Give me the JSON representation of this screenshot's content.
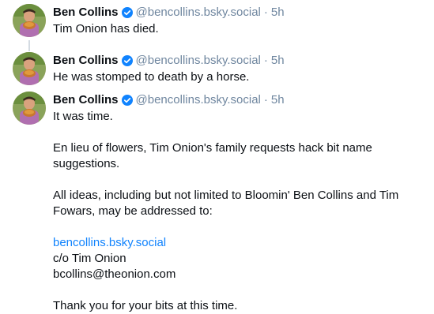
{
  "posts": [
    {
      "author": "Ben Collins",
      "handle": "@bencollins.bsky.social",
      "separator": "·",
      "time": "5h",
      "text": "Tim Onion has died."
    },
    {
      "author": "Ben Collins",
      "handle": "@bencollins.bsky.social",
      "separator": "·",
      "time": "5h",
      "text": "He was stomped to death by a horse."
    },
    {
      "author": "Ben Collins",
      "handle": "@bencollins.bsky.social",
      "separator": "·",
      "time": "5h",
      "paragraphs": [
        "It was time.",
        "En lieu of flowers, Tim Onion's family requests hack bit name suggestions.",
        "All ideas, including but not limited to Bloomin' Ben Collins and Tim Fowars, may be addressed to:"
      ],
      "address": {
        "link": "bencollins.bsky.social",
        "line2": "c/o Tim Onion",
        "line3": "bcollins@theonion.com"
      },
      "closing": "Thank you for your bits at this time."
    }
  ],
  "colors": {
    "text": "#0b0f14",
    "muted": "#6f869f",
    "link": "#1083fe",
    "verified": "#1083fe",
    "thread_line": "#d4dbe2"
  },
  "icons": {
    "verified": "verified-badge-icon",
    "avatar": "avatar-photo"
  }
}
